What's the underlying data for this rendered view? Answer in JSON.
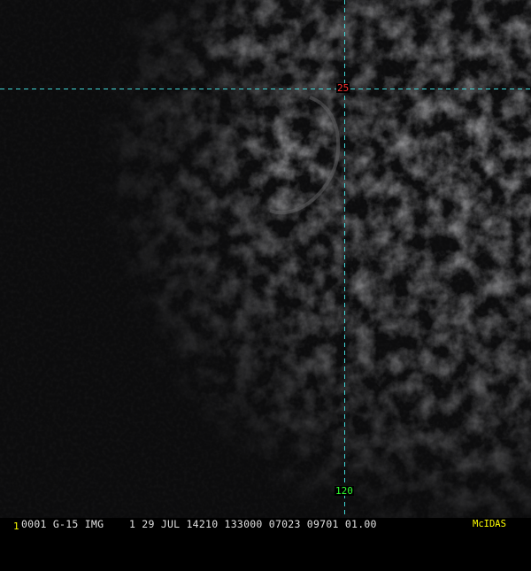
{
  "image": {
    "description_kind": "GOES-15 visible satellite image with lat/lon grid",
    "grid_color": "#40d8d8",
    "background_color": "#000000"
  },
  "grid": {
    "latitude_label": "25",
    "longitude_label": "120",
    "latitude_label_color": "#ff3030",
    "longitude_label_color": "#30ff30"
  },
  "info_bar": {
    "frame": "1",
    "header": "0001 G-15 IMG    1 29 JUL 14210 133000 07023 09701 01.00",
    "software": "McIDAS",
    "frame_color": "#ffff00",
    "software_color": "#ffff00"
  }
}
